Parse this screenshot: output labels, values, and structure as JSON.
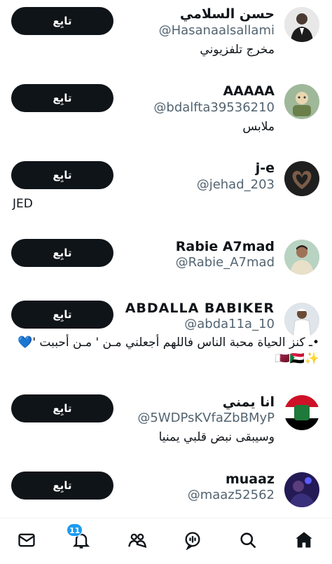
{
  "follow_label": "تابِع",
  "users": [
    {
      "name": "حسن السلامي",
      "handle": "@Hasanaalsallami",
      "bio": "مخرج تلفزيوني",
      "avatar_icon": "person-suit-avatar"
    },
    {
      "name": "AAAAA",
      "handle": "@bdalfta39536210",
      "bio": "ملابس",
      "avatar_icon": "cartoon-avatar"
    },
    {
      "name": "j-e",
      "handle": "@jehad_203",
      "bio": "JED",
      "avatar_icon": "heart-hands-avatar"
    },
    {
      "name": "Rabie A7mad",
      "handle": "@Rabie_A7mad",
      "bio": "",
      "avatar_icon": "person-avatar"
    },
    {
      "name": "ABDALLA BABIKER",
      "handle": "@abda11a_10",
      "bio": "•ـ كنز الحياة محبة الناس فاللهم أجعلني مـن ' مـن أحببت '💙✨🇶🇦🇸🇩",
      "avatar_icon": "person-white-robe-avatar"
    },
    {
      "name": "انا يمني",
      "handle": "@5WDPsKVfaZbBMyP",
      "bio": "وسيبقى نبض قلبي يمنيا",
      "avatar_icon": "flag-avatar"
    },
    {
      "name": "muaaz",
      "handle": "@maaz52562",
      "bio": "",
      "avatar_icon": "night-person-avatar"
    }
  ],
  "tabbar": {
    "notifications_badge": "11",
    "icons": [
      "mail-icon",
      "bell-icon",
      "people-icon",
      "spaces-icon",
      "search-icon",
      "home-icon"
    ]
  }
}
